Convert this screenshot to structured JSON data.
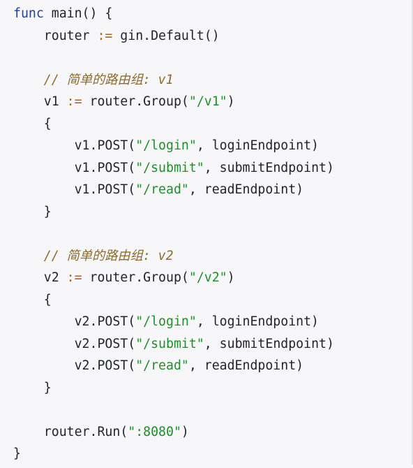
{
  "colors": {
    "background": "#f7f7f9",
    "keyword": "#1f3f99",
    "operator": "#b0620f",
    "string": "#218c2e",
    "comment": "#8b6a2e",
    "text": "#1f2328"
  },
  "code": {
    "lines": [
      [
        {
          "t": "func",
          "k": "kw"
        },
        {
          "t": " main() {",
          "k": "txt"
        }
      ],
      [
        {
          "t": "    router ",
          "k": "txt"
        },
        {
          "t": ":=",
          "k": "op"
        },
        {
          "t": " gin.Default()",
          "k": "txt"
        }
      ],
      [],
      [
        {
          "t": "    // 简单的路由组: v1",
          "k": "cmt"
        }
      ],
      [
        {
          "t": "    v1 ",
          "k": "txt"
        },
        {
          "t": ":=",
          "k": "op"
        },
        {
          "t": " router.Group(",
          "k": "txt"
        },
        {
          "t": "\"/v1\"",
          "k": "str"
        },
        {
          "t": ")",
          "k": "txt"
        }
      ],
      [
        {
          "t": "    {",
          "k": "txt"
        }
      ],
      [
        {
          "t": "        v1.POST(",
          "k": "txt"
        },
        {
          "t": "\"/login\"",
          "k": "str"
        },
        {
          "t": ", loginEndpoint)",
          "k": "txt"
        }
      ],
      [
        {
          "t": "        v1.POST(",
          "k": "txt"
        },
        {
          "t": "\"/submit\"",
          "k": "str"
        },
        {
          "t": ", submitEndpoint)",
          "k": "txt"
        }
      ],
      [
        {
          "t": "        v1.POST(",
          "k": "txt"
        },
        {
          "t": "\"/read\"",
          "k": "str"
        },
        {
          "t": ", readEndpoint)",
          "k": "txt"
        }
      ],
      [
        {
          "t": "    }",
          "k": "txt"
        }
      ],
      [],
      [
        {
          "t": "    // 简单的路由组: v2",
          "k": "cmt"
        }
      ],
      [
        {
          "t": "    v2 ",
          "k": "txt"
        },
        {
          "t": ":=",
          "k": "op"
        },
        {
          "t": " router.Group(",
          "k": "txt"
        },
        {
          "t": "\"/v2\"",
          "k": "str"
        },
        {
          "t": ")",
          "k": "txt"
        }
      ],
      [
        {
          "t": "    {",
          "k": "txt"
        }
      ],
      [
        {
          "t": "        v2.POST(",
          "k": "txt"
        },
        {
          "t": "\"/login\"",
          "k": "str"
        },
        {
          "t": ", loginEndpoint)",
          "k": "txt"
        }
      ],
      [
        {
          "t": "        v2.POST(",
          "k": "txt"
        },
        {
          "t": "\"/submit\"",
          "k": "str"
        },
        {
          "t": ", submitEndpoint)",
          "k": "txt"
        }
      ],
      [
        {
          "t": "        v2.POST(",
          "k": "txt"
        },
        {
          "t": "\"/read\"",
          "k": "str"
        },
        {
          "t": ", readEndpoint)",
          "k": "txt"
        }
      ],
      [
        {
          "t": "    }",
          "k": "txt"
        }
      ],
      [],
      [
        {
          "t": "    router.Run(",
          "k": "txt"
        },
        {
          "t": "\":8080\"",
          "k": "str"
        },
        {
          "t": ")",
          "k": "txt"
        }
      ],
      [
        {
          "t": "}",
          "k": "txt"
        }
      ]
    ]
  }
}
